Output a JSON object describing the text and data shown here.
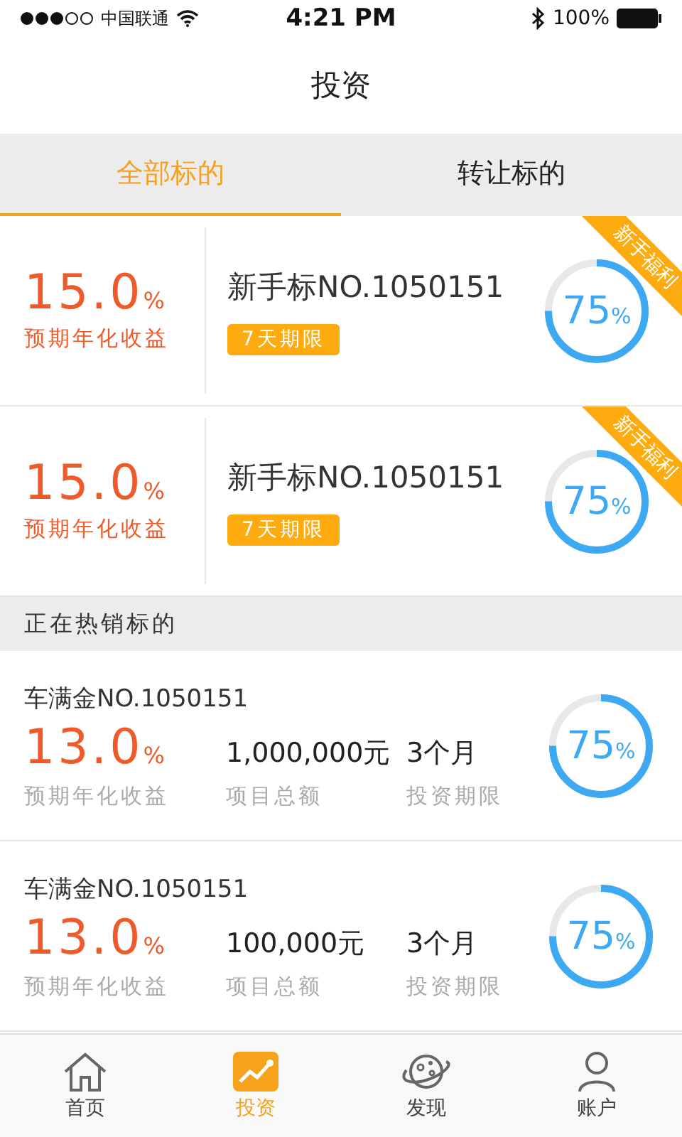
{
  "status_bar": {
    "carrier": "中国联通",
    "time": "4:21 PM",
    "battery": "100%"
  },
  "nav_bar": {
    "title": "投资"
  },
  "tabs": [
    {
      "label": "全部标的",
      "selected": true
    },
    {
      "label": "转让标的",
      "selected": false
    }
  ],
  "featured": [
    {
      "rate": "15.0",
      "rate_unit": "%",
      "rate_label": "预期年化收益",
      "name": "新手标NO.1050151",
      "term_badge": "7天期限",
      "ribbon": "新手福利",
      "progress": {
        "level": 0.75,
        "value": "75",
        "unit": "%"
      }
    },
    {
      "rate": "15.0",
      "rate_unit": "%",
      "rate_label": "预期年化收益",
      "name": "新手标NO.1050151",
      "term_badge": "7天期限",
      "ribbon": "新手福利",
      "progress": {
        "level": 0.75,
        "value": "75",
        "unit": "%"
      }
    }
  ],
  "section_header": "正在热销标的",
  "products": [
    {
      "name": "车满金NO.1050151",
      "rate": "13.0",
      "rate_unit": "%",
      "rate_label": "预期年化收益",
      "amount": "1,000,000元",
      "amount_label": "项目总额",
      "term": "3个月",
      "term_label": "投资期限",
      "progress": {
        "level": 0.75,
        "value": "75",
        "unit": "%"
      }
    },
    {
      "name": "车满金NO.1050151",
      "rate": "13.0",
      "rate_unit": "%",
      "rate_label": "预期年化收益",
      "amount": "100,000元",
      "amount_label": "项目总额",
      "term": "3个月",
      "term_label": "投资期限",
      "progress": {
        "level": 0.75,
        "value": "75",
        "unit": "%"
      }
    }
  ],
  "tab_bar": [
    {
      "kind": "home",
      "label": "首页",
      "selected": false
    },
    {
      "kind": "invest",
      "label": "投资",
      "selected": true
    },
    {
      "kind": "discover",
      "label": "发现",
      "selected": false
    },
    {
      "kind": "account",
      "label": "账户",
      "selected": false
    }
  ]
}
